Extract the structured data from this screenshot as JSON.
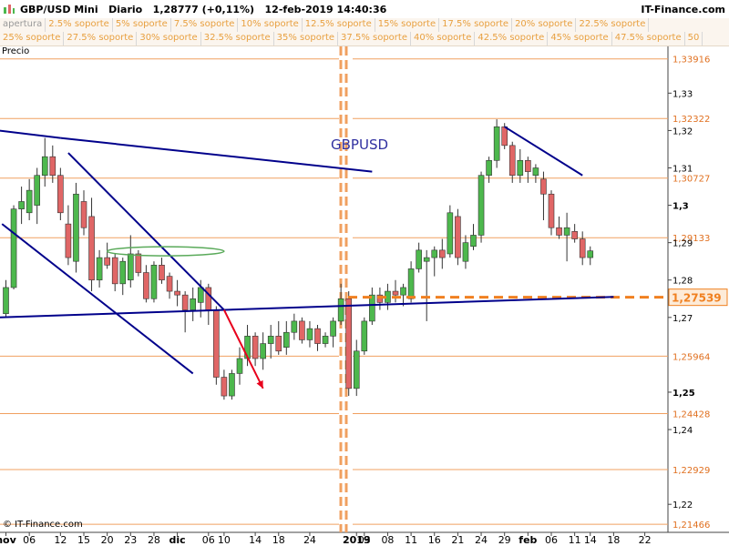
{
  "header": {
    "title": "GBP/USD Mini   Diario   1,28777 (+0,11%)   12-feb-2019 14:40:36",
    "brand": "IT-Finance.com"
  },
  "legend": {
    "row1": [
      "apertura",
      "2.5% soporte",
      "5% soporte",
      "7.5% soporte",
      "10% soporte",
      "12.5% soporte",
      "15% soporte",
      "17.5% soporte",
      "20% soporte",
      "22.5% soporte"
    ],
    "row2": [
      "25% soporte",
      "27.5% soporte",
      "30% soporte",
      "32.5% soporte",
      "35% soporte",
      "37.5% soporte",
      "40% soporte",
      "42.5% soporte",
      "45% soporte",
      "47.5% soporte",
      "50"
    ]
  },
  "panel_label": "Precio",
  "watermark": "© IT-Finance.com",
  "colors": {
    "up": "#4db84d",
    "down": "#e06666",
    "level": "#f0a060",
    "trend": "#00008b",
    "arrow": "#e8001c",
    "ellipse": "#5aaa5a",
    "current": "#f08020"
  },
  "chart_data": {
    "type": "candlestick",
    "symbol_label": "GBPUSD",
    "ylim": [
      1.2125,
      1.3425
    ],
    "ytick_labels": [
      "1,33",
      "1,32",
      "1,31",
      "1,3",
      "1,29",
      "1,28",
      "1,27",
      "1,25",
      "1,24",
      "1,22"
    ],
    "ytick_values": [
      1.33,
      1.32,
      1.31,
      1.3,
      1.29,
      1.28,
      1.27,
      1.25,
      1.24,
      1.22
    ],
    "ytick_bold": [
      false,
      false,
      false,
      true,
      false,
      false,
      false,
      true,
      false,
      false
    ],
    "x_labels": [
      {
        "text": "nov",
        "i": 0,
        "bold": true
      },
      {
        "text": "06",
        "i": 3
      },
      {
        "text": "12",
        "i": 7
      },
      {
        "text": "15",
        "i": 10
      },
      {
        "text": "20",
        "i": 13
      },
      {
        "text": "23",
        "i": 16
      },
      {
        "text": "28",
        "i": 19
      },
      {
        "text": "dic",
        "i": 22,
        "bold": true
      },
      {
        "text": "06",
        "i": 26
      },
      {
        "text": "10",
        "i": 28
      },
      {
        "text": "14",
        "i": 32
      },
      {
        "text": "18",
        "i": 35
      },
      {
        "text": "24",
        "i": 39
      },
      {
        "text": "2019",
        "i": 45,
        "bold": true
      },
      {
        "text": "03",
        "i": 46
      },
      {
        "text": "08",
        "i": 49
      },
      {
        "text": "11",
        "i": 52
      },
      {
        "text": "16",
        "i": 55
      },
      {
        "text": "21",
        "i": 58
      },
      {
        "text": "24",
        "i": 61
      },
      {
        "text": "29",
        "i": 64
      },
      {
        "text": "feb",
        "i": 67,
        "bold": true
      },
      {
        "text": "06",
        "i": 70
      },
      {
        "text": "11",
        "i": 73
      },
      {
        "text": "14",
        "i": 75
      },
      {
        "text": "18",
        "i": 78
      },
      {
        "text": "22",
        "i": 82
      }
    ],
    "levels": [
      {
        "value": 1.33916,
        "label": "1,33916"
      },
      {
        "value": 1.32322,
        "label": "1,32322"
      },
      {
        "value": 1.30727,
        "label": "1,30727"
      },
      {
        "value": 1.29133,
        "label": "1,29133"
      },
      {
        "value": 1.25964,
        "label": "1,25964"
      },
      {
        "value": 1.24428,
        "label": "1,24428"
      },
      {
        "value": 1.22929,
        "label": "1,22929"
      },
      {
        "value": 1.21466,
        "label": "1,21466"
      }
    ],
    "current_price": {
      "value": 1.27539,
      "label": "1,27539"
    },
    "candles": [
      {
        "i": 0,
        "o": 1.271,
        "h": 1.28,
        "l": 1.27,
        "c": 1.278
      },
      {
        "i": 1,
        "o": 1.278,
        "h": 1.3,
        "l": 1.2775,
        "c": 1.299
      },
      {
        "i": 2,
        "o": 1.299,
        "h": 1.305,
        "l": 1.295,
        "c": 1.301
      },
      {
        "i": 3,
        "o": 1.298,
        "h": 1.307,
        "l": 1.296,
        "c": 1.304
      },
      {
        "i": 4,
        "o": 1.3,
        "h": 1.31,
        "l": 1.295,
        "c": 1.308
      },
      {
        "i": 5,
        "o": 1.308,
        "h": 1.318,
        "l": 1.305,
        "c": 1.313
      },
      {
        "i": 6,
        "o": 1.313,
        "h": 1.316,
        "l": 1.306,
        "c": 1.308
      },
      {
        "i": 7,
        "o": 1.308,
        "h": 1.31,
        "l": 1.296,
        "c": 1.298
      },
      {
        "i": 8,
        "o": 1.295,
        "h": 1.3,
        "l": 1.284,
        "c": 1.286
      },
      {
        "i": 9,
        "o": 1.285,
        "h": 1.306,
        "l": 1.282,
        "c": 1.303
      },
      {
        "i": 10,
        "o": 1.301,
        "h": 1.304,
        "l": 1.292,
        "c": 1.294
      },
      {
        "i": 11,
        "o": 1.297,
        "h": 1.302,
        "l": 1.277,
        "c": 1.28
      },
      {
        "i": 12,
        "o": 1.28,
        "h": 1.288,
        "l": 1.278,
        "c": 1.286
      },
      {
        "i": 13,
        "o": 1.286,
        "h": 1.29,
        "l": 1.283,
        "c": 1.284
      },
      {
        "i": 14,
        "o": 1.286,
        "h": 1.287,
        "l": 1.277,
        "c": 1.279
      },
      {
        "i": 15,
        "o": 1.279,
        "h": 1.286,
        "l": 1.276,
        "c": 1.285
      },
      {
        "i": 16,
        "o": 1.28,
        "h": 1.292,
        "l": 1.278,
        "c": 1.287
      },
      {
        "i": 17,
        "o": 1.287,
        "h": 1.288,
        "l": 1.281,
        "c": 1.282
      },
      {
        "i": 18,
        "o": 1.282,
        "h": 1.284,
        "l": 1.274,
        "c": 1.275
      },
      {
        "i": 19,
        "o": 1.275,
        "h": 1.285,
        "l": 1.274,
        "c": 1.284
      },
      {
        "i": 20,
        "o": 1.284,
        "h": 1.286,
        "l": 1.279,
        "c": 1.28
      },
      {
        "i": 21,
        "o": 1.281,
        "h": 1.282,
        "l": 1.275,
        "c": 1.277
      },
      {
        "i": 22,
        "o": 1.277,
        "h": 1.28,
        "l": 1.273,
        "c": 1.276
      },
      {
        "i": 23,
        "o": 1.276,
        "h": 1.277,
        "l": 1.266,
        "c": 1.272
      },
      {
        "i": 24,
        "o": 1.272,
        "h": 1.278,
        "l": 1.269,
        "c": 1.275
      },
      {
        "i": 25,
        "o": 1.274,
        "h": 1.28,
        "l": 1.27,
        "c": 1.278
      },
      {
        "i": 26,
        "o": 1.278,
        "h": 1.279,
        "l": 1.268,
        "c": 1.272
      },
      {
        "i": 27,
        "o": 1.272,
        "h": 1.273,
        "l": 1.252,
        "c": 1.254
      },
      {
        "i": 28,
        "o": 1.254,
        "h": 1.256,
        "l": 1.248,
        "c": 1.249
      },
      {
        "i": 29,
        "o": 1.249,
        "h": 1.256,
        "l": 1.248,
        "c": 1.255
      },
      {
        "i": 30,
        "o": 1.255,
        "h": 1.262,
        "l": 1.252,
        "c": 1.259
      },
      {
        "i": 31,
        "o": 1.259,
        "h": 1.268,
        "l": 1.257,
        "c": 1.265
      },
      {
        "i": 32,
        "o": 1.265,
        "h": 1.266,
        "l": 1.257,
        "c": 1.259
      },
      {
        "i": 33,
        "o": 1.259,
        "h": 1.266,
        "l": 1.256,
        "c": 1.263
      },
      {
        "i": 34,
        "o": 1.263,
        "h": 1.268,
        "l": 1.259,
        "c": 1.265
      },
      {
        "i": 35,
        "o": 1.265,
        "h": 1.269,
        "l": 1.26,
        "c": 1.261
      },
      {
        "i": 36,
        "o": 1.262,
        "h": 1.269,
        "l": 1.26,
        "c": 1.266
      },
      {
        "i": 37,
        "o": 1.266,
        "h": 1.271,
        "l": 1.264,
        "c": 1.269
      },
      {
        "i": 38,
        "o": 1.269,
        "h": 1.27,
        "l": 1.263,
        "c": 1.264
      },
      {
        "i": 39,
        "o": 1.264,
        "h": 1.269,
        "l": 1.262,
        "c": 1.267
      },
      {
        "i": 40,
        "o": 1.267,
        "h": 1.268,
        "l": 1.261,
        "c": 1.263
      },
      {
        "i": 41,
        "o": 1.263,
        "h": 1.266,
        "l": 1.262,
        "c": 1.265
      },
      {
        "i": 42,
        "o": 1.265,
        "h": 1.27,
        "l": 1.262,
        "c": 1.269
      },
      {
        "i": 43,
        "o": 1.269,
        "h": 1.279,
        "l": 1.268,
        "c": 1.275
      },
      {
        "i": 44,
        "o": 1.275,
        "h": 1.277,
        "l": 1.249,
        "c": 1.251
      },
      {
        "i": 45,
        "o": 1.251,
        "h": 1.264,
        "l": 1.249,
        "c": 1.261
      },
      {
        "i": 46,
        "o": 1.261,
        "h": 1.27,
        "l": 1.26,
        "c": 1.269
      },
      {
        "i": 47,
        "o": 1.269,
        "h": 1.278,
        "l": 1.268,
        "c": 1.276
      },
      {
        "i": 48,
        "o": 1.276,
        "h": 1.278,
        "l": 1.272,
        "c": 1.274
      },
      {
        "i": 49,
        "o": 1.274,
        "h": 1.279,
        "l": 1.272,
        "c": 1.277
      },
      {
        "i": 50,
        "o": 1.277,
        "h": 1.28,
        "l": 1.274,
        "c": 1.276
      },
      {
        "i": 51,
        "o": 1.276,
        "h": 1.279,
        "l": 1.273,
        "c": 1.278
      },
      {
        "i": 52,
        "o": 1.275,
        "h": 1.285,
        "l": 1.274,
        "c": 1.283
      },
      {
        "i": 53,
        "o": 1.283,
        "h": 1.29,
        "l": 1.282,
        "c": 1.288
      },
      {
        "i": 54,
        "o": 1.285,
        "h": 1.288,
        "l": 1.269,
        "c": 1.286
      },
      {
        "i": 55,
        "o": 1.286,
        "h": 1.289,
        "l": 1.281,
        "c": 1.288
      },
      {
        "i": 56,
        "o": 1.288,
        "h": 1.291,
        "l": 1.283,
        "c": 1.286
      },
      {
        "i": 57,
        "o": 1.287,
        "h": 1.3,
        "l": 1.286,
        "c": 1.298
      },
      {
        "i": 58,
        "o": 1.297,
        "h": 1.299,
        "l": 1.284,
        "c": 1.286
      },
      {
        "i": 59,
        "o": 1.285,
        "h": 1.292,
        "l": 1.283,
        "c": 1.29
      },
      {
        "i": 60,
        "o": 1.289,
        "h": 1.295,
        "l": 1.288,
        "c": 1.292
      },
      {
        "i": 61,
        "o": 1.292,
        "h": 1.309,
        "l": 1.29,
        "c": 1.308
      },
      {
        "i": 62,
        "o": 1.308,
        "h": 1.313,
        "l": 1.306,
        "c": 1.312
      },
      {
        "i": 63,
        "o": 1.312,
        "h": 1.323,
        "l": 1.31,
        "c": 1.321
      },
      {
        "i": 64,
        "o": 1.321,
        "h": 1.322,
        "l": 1.315,
        "c": 1.316
      },
      {
        "i": 65,
        "o": 1.316,
        "h": 1.317,
        "l": 1.306,
        "c": 1.308
      },
      {
        "i": 66,
        "o": 1.308,
        "h": 1.315,
        "l": 1.306,
        "c": 1.312
      },
      {
        "i": 67,
        "o": 1.312,
        "h": 1.313,
        "l": 1.306,
        "c": 1.309
      },
      {
        "i": 68,
        "o": 1.308,
        "h": 1.311,
        "l": 1.306,
        "c": 1.31
      },
      {
        "i": 69,
        "o": 1.307,
        "h": 1.309,
        "l": 1.296,
        "c": 1.303
      },
      {
        "i": 70,
        "o": 1.303,
        "h": 1.304,
        "l": 1.292,
        "c": 1.294
      },
      {
        "i": 71,
        "o": 1.294,
        "h": 1.297,
        "l": 1.291,
        "c": 1.292
      },
      {
        "i": 72,
        "o": 1.292,
        "h": 1.298,
        "l": 1.285,
        "c": 1.294
      },
      {
        "i": 73,
        "o": 1.293,
        "h": 1.295,
        "l": 1.29,
        "c": 1.291
      },
      {
        "i": 74,
        "o": 1.291,
        "h": 1.293,
        "l": 1.284,
        "c": 1.286
      },
      {
        "i": 75,
        "o": 1.286,
        "h": 1.289,
        "l": 1.284,
        "c": 1.2878
      }
    ],
    "trendlines": [
      {
        "i1": -1,
        "v1": 1.32,
        "i2": 7,
        "v2": 1.318
      },
      {
        "i1": 7,
        "v1": 1.318,
        "i2": 47,
        "v2": 1.309
      },
      {
        "i1": -1,
        "v1": 1.27,
        "i2": 78,
        "v2": 1.2755
      },
      {
        "i1": -0.5,
        "v1": 1.295,
        "i2": 24,
        "v2": 1.255
      },
      {
        "i1": 8,
        "v1": 1.314,
        "i2": 28,
        "v2": 1.272
      },
      {
        "i1": 64,
        "v1": 1.321,
        "i2": 74,
        "v2": 1.308
      }
    ],
    "arrow": {
      "i1": 28,
      "v1": 1.272,
      "i2": 33,
      "v2": 1.251
    },
    "ellipse": {
      "i1": 13,
      "i2": 28,
      "value": 1.2877
    }
  }
}
